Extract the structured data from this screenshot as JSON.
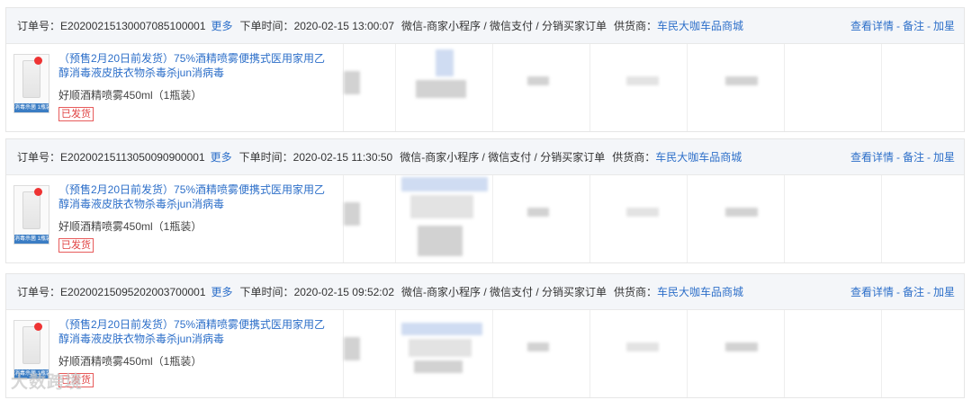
{
  "labels": {
    "order_no": "订单号：",
    "more": "更多",
    "order_time": "下单时间：",
    "supplier": "供货商：",
    "view_details": "查看详情",
    "remark": "备注",
    "add_star": "加星",
    "separator": "-"
  },
  "orders": [
    {
      "order_no": "E20200215130007085100001",
      "order_time": "2020-02-15 13:00:07",
      "channel": "微信-商家小程序 / 微信支付 / 分销买家订单",
      "supplier": "车民大咖车品商城",
      "product": {
        "title": "（预售2月20日前发货）75%酒精喷雾便携式医用家用乙醇消毒液皮肤衣物杀毒杀jun消病毒",
        "spec": "好顺酒精喷雾450ml（1瓶装）",
        "status": "已发货",
        "thumb_caption": "消毒杀菌 1瓶装"
      }
    },
    {
      "order_no": "E20200215113050090900001",
      "order_time": "2020-02-15 11:30:50",
      "channel": "微信-商家小程序 / 微信支付 / 分销买家订单",
      "supplier": "车民大咖车品商城",
      "product": {
        "title": "（预售2月20日前发货）75%酒精喷雾便携式医用家用乙醇消毒液皮肤衣物杀毒杀jun消病毒",
        "spec": "好顺酒精喷雾450ml（1瓶装）",
        "status": "已发货",
        "thumb_caption": "消毒杀菌 1瓶装"
      }
    },
    {
      "order_no": "E20200215095202003700001",
      "order_time": "2020-02-15 09:52:02",
      "channel": "微信-商家小程序 / 微信支付 / 分销买家订单",
      "supplier": "车民大咖车品商城",
      "product": {
        "title": "（预售2月20日前发货）75%酒精喷雾便携式医用家用乙醇消毒液皮肤衣物杀毒杀jun消病毒",
        "spec": "好顺酒精喷雾450ml（1瓶装）",
        "status": "已发货",
        "thumb_caption": "消毒杀菌 1瓶装"
      }
    }
  ],
  "watermark": "大数跨境",
  "colors": {
    "link": "#2d6fc9",
    "header_bg": "#f4f6f9",
    "status_red": "#e04444"
  }
}
